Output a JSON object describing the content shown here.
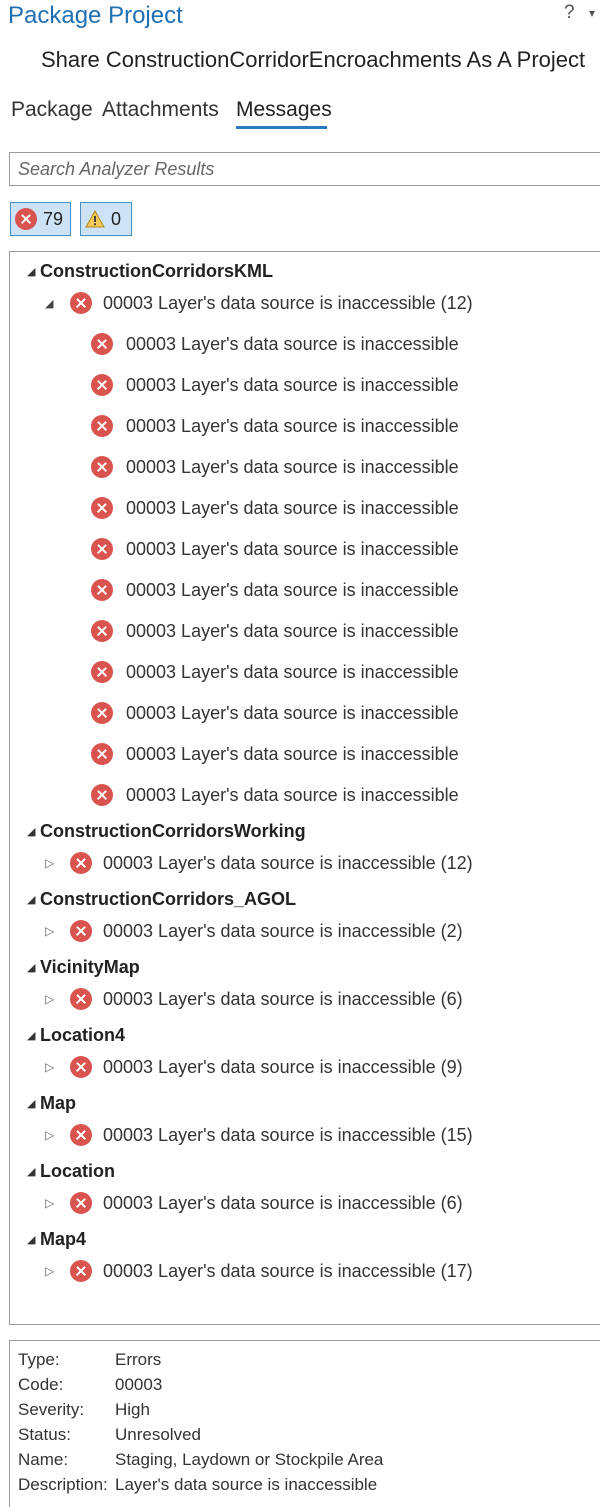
{
  "window": {
    "title": "Package Project",
    "help_glyph": "?",
    "menu_glyph": "▾"
  },
  "subtitle": "Share ConstructionCorridorEncroachments As A Project",
  "tabs": [
    {
      "label": "Package",
      "active": false
    },
    {
      "label": "Attachments",
      "active": false
    },
    {
      "label": "Messages",
      "active": true
    }
  ],
  "search": {
    "placeholder": "Search Analyzer Results",
    "value": ""
  },
  "filters": {
    "errors_count": "79",
    "warnings_count": "0"
  },
  "colors": {
    "accent": "#2b7bc0",
    "error": "#d9534f",
    "selection": "#c9e0f2"
  },
  "tree": {
    "groups": [
      {
        "name": "ConstructionCorridorsKML",
        "expanded": true,
        "message": "00003 Layer's data source is inaccessible (12)",
        "children": [
          "00003 Layer's data source is inaccessible",
          "00003 Layer's data source is inaccessible",
          "00003 Layer's data source is inaccessible",
          "00003 Layer's data source is inaccessible",
          "00003 Layer's data source is inaccessible",
          "00003 Layer's data source is inaccessible",
          "00003 Layer's data source is inaccessible",
          "00003 Layer's data source is inaccessible",
          "00003 Layer's data source is inaccessible",
          "00003 Layer's data source is inaccessible",
          "00003 Layer's data source is inaccessible",
          "00003 Layer's data source is inaccessible"
        ],
        "selected_child": 1
      },
      {
        "name": "ConstructionCorridorsWorking",
        "expanded": false,
        "message": "00003 Layer's data source is inaccessible (12)"
      },
      {
        "name": "ConstructionCorridors_AGOL",
        "expanded": false,
        "message": "00003 Layer's data source is inaccessible (2)"
      },
      {
        "name": "VicinityMap",
        "expanded": false,
        "message": "00003 Layer's data source is inaccessible (6)"
      },
      {
        "name": "Location4",
        "expanded": false,
        "message": "00003 Layer's data source is inaccessible (9)"
      },
      {
        "name": "Map",
        "expanded": false,
        "message": "00003 Layer's data source is inaccessible (15)"
      },
      {
        "name": "Location",
        "expanded": false,
        "message": "00003 Layer's data source is inaccessible (6)"
      },
      {
        "name": "Map4",
        "expanded": false,
        "message": "00003 Layer's data source is inaccessible (17)"
      }
    ]
  },
  "details": [
    {
      "key": "Type:",
      "value": "Errors"
    },
    {
      "key": "Code:",
      "value": "00003"
    },
    {
      "key": "Severity:",
      "value": "High"
    },
    {
      "key": "Status:",
      "value": "Unresolved"
    },
    {
      "key": "Name:",
      "value": "Staging, Laydown or Stockpile Area"
    },
    {
      "key": "Description:",
      "value": "Layer's data source is inaccessible"
    }
  ]
}
